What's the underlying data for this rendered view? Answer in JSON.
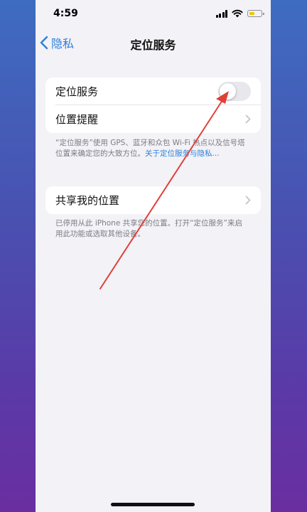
{
  "status_bar": {
    "time": "4:59",
    "battery_level": 0.45,
    "battery_color": "#f2c400"
  },
  "nav": {
    "back_label": "隐私",
    "title": "定位服务"
  },
  "location_group": {
    "toggle_label": "定位服务",
    "toggle_on": false,
    "alerts_label": "位置提醒"
  },
  "location_footnote": {
    "text": "“定位服务”使用 GPS、蓝牙和众包 Wi-Fi 热点以及信号塔位置来确定您的大致方位。",
    "link": "关于定位服务与隐私..."
  },
  "share_group": {
    "label": "共享我的位置"
  },
  "share_footnote": {
    "text": "已停用从此 iPhone 共享您的位置。打开“定位服务”来启用此功能或选取其他设备。"
  },
  "colors": {
    "accent": "#2f80d8",
    "annotation_arrow": "#e0403a",
    "screen_bg": "#f2f2f7",
    "backdrop_top": "#3e6cc0",
    "backdrop_bottom": "#6a2ea0"
  }
}
